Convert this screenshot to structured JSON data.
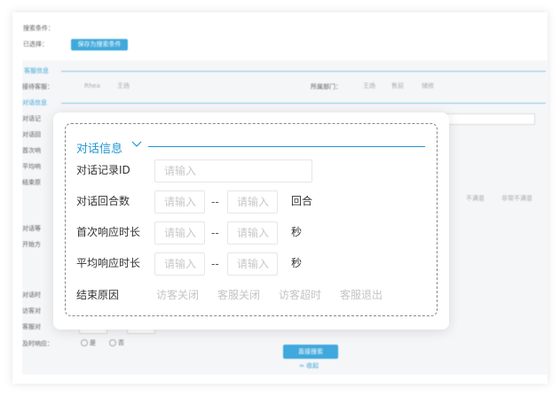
{
  "background": {
    "search_conditions_label": "搜索条件：",
    "selected_label": "已选择：",
    "save_condition_button": "保存为搜索条件",
    "agent_info_title": "客服信息",
    "operator_label": "接待客服：",
    "operators": [
      "Rhea",
      "王炀"
    ],
    "department_label": "所属部门：",
    "departments": [
      "王炀",
      "售前",
      "储修"
    ],
    "dialog_info_title": "对话信息",
    "row_labels": [
      "对话记",
      "对话回",
      "首次响",
      "平均响",
      "结束原"
    ],
    "satisfaction_options": [
      "不满意",
      "非常不满意"
    ],
    "extra_labels": [
      "对话等",
      "开始方"
    ],
    "lower_labels": [
      "对话时",
      "访客对",
      "客服对"
    ],
    "timely_label": "及时响应：",
    "yes_label": "是",
    "no_label": "否",
    "search_button": "直接搜索",
    "collapse_link": "≈ 收起"
  },
  "popup": {
    "section_title": "对话信息",
    "fields": {
      "record_id": {
        "label": "对话记录ID",
        "placeholder": "请输入"
      },
      "rounds": {
        "label": "对话回合数",
        "from_placeholder": "请输入",
        "separator": "--",
        "to_placeholder": "请输入",
        "unit": "回合"
      },
      "first_response": {
        "label": "首次响应时长",
        "from_placeholder": "请输入",
        "separator": "--",
        "to_placeholder": "请输入",
        "unit": "秒"
      },
      "avg_response": {
        "label": "平均响应时长",
        "from_placeholder": "请输入",
        "separator": "--",
        "to_placeholder": "请输入",
        "unit": "秒"
      }
    },
    "end_reason": {
      "label": "结束原因",
      "options": [
        "访客关闭",
        "客服关闭",
        "访客超时",
        "客服退出"
      ]
    }
  },
  "colors": {
    "accent": "#1e96d2",
    "button_bg": "#1e9ad6",
    "placeholder": "#c8c8c8",
    "option_text": "#c4c4c4"
  }
}
